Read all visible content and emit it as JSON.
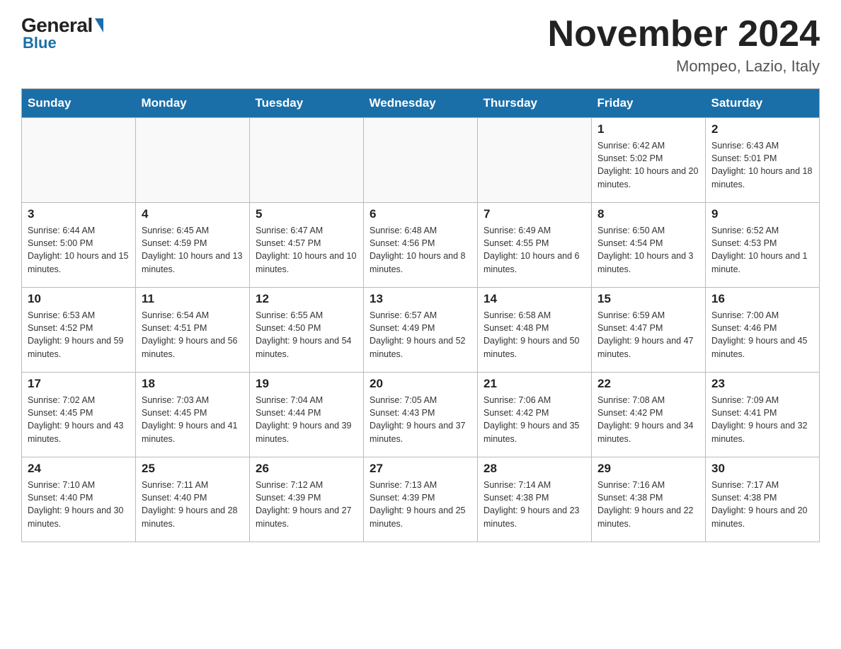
{
  "header": {
    "logo_general": "General",
    "logo_blue": "Blue",
    "title": "November 2024",
    "subtitle": "Mompeo, Lazio, Italy"
  },
  "weekdays": [
    "Sunday",
    "Monday",
    "Tuesday",
    "Wednesday",
    "Thursday",
    "Friday",
    "Saturday"
  ],
  "weeks": [
    [
      {
        "day": "",
        "sunrise": "",
        "sunset": "",
        "daylight": ""
      },
      {
        "day": "",
        "sunrise": "",
        "sunset": "",
        "daylight": ""
      },
      {
        "day": "",
        "sunrise": "",
        "sunset": "",
        "daylight": ""
      },
      {
        "day": "",
        "sunrise": "",
        "sunset": "",
        "daylight": ""
      },
      {
        "day": "",
        "sunrise": "",
        "sunset": "",
        "daylight": ""
      },
      {
        "day": "1",
        "sunrise": "Sunrise: 6:42 AM",
        "sunset": "Sunset: 5:02 PM",
        "daylight": "Daylight: 10 hours and 20 minutes."
      },
      {
        "day": "2",
        "sunrise": "Sunrise: 6:43 AM",
        "sunset": "Sunset: 5:01 PM",
        "daylight": "Daylight: 10 hours and 18 minutes."
      }
    ],
    [
      {
        "day": "3",
        "sunrise": "Sunrise: 6:44 AM",
        "sunset": "Sunset: 5:00 PM",
        "daylight": "Daylight: 10 hours and 15 minutes."
      },
      {
        "day": "4",
        "sunrise": "Sunrise: 6:45 AM",
        "sunset": "Sunset: 4:59 PM",
        "daylight": "Daylight: 10 hours and 13 minutes."
      },
      {
        "day": "5",
        "sunrise": "Sunrise: 6:47 AM",
        "sunset": "Sunset: 4:57 PM",
        "daylight": "Daylight: 10 hours and 10 minutes."
      },
      {
        "day": "6",
        "sunrise": "Sunrise: 6:48 AM",
        "sunset": "Sunset: 4:56 PM",
        "daylight": "Daylight: 10 hours and 8 minutes."
      },
      {
        "day": "7",
        "sunrise": "Sunrise: 6:49 AM",
        "sunset": "Sunset: 4:55 PM",
        "daylight": "Daylight: 10 hours and 6 minutes."
      },
      {
        "day": "8",
        "sunrise": "Sunrise: 6:50 AM",
        "sunset": "Sunset: 4:54 PM",
        "daylight": "Daylight: 10 hours and 3 minutes."
      },
      {
        "day": "9",
        "sunrise": "Sunrise: 6:52 AM",
        "sunset": "Sunset: 4:53 PM",
        "daylight": "Daylight: 10 hours and 1 minute."
      }
    ],
    [
      {
        "day": "10",
        "sunrise": "Sunrise: 6:53 AM",
        "sunset": "Sunset: 4:52 PM",
        "daylight": "Daylight: 9 hours and 59 minutes."
      },
      {
        "day": "11",
        "sunrise": "Sunrise: 6:54 AM",
        "sunset": "Sunset: 4:51 PM",
        "daylight": "Daylight: 9 hours and 56 minutes."
      },
      {
        "day": "12",
        "sunrise": "Sunrise: 6:55 AM",
        "sunset": "Sunset: 4:50 PM",
        "daylight": "Daylight: 9 hours and 54 minutes."
      },
      {
        "day": "13",
        "sunrise": "Sunrise: 6:57 AM",
        "sunset": "Sunset: 4:49 PM",
        "daylight": "Daylight: 9 hours and 52 minutes."
      },
      {
        "day": "14",
        "sunrise": "Sunrise: 6:58 AM",
        "sunset": "Sunset: 4:48 PM",
        "daylight": "Daylight: 9 hours and 50 minutes."
      },
      {
        "day": "15",
        "sunrise": "Sunrise: 6:59 AM",
        "sunset": "Sunset: 4:47 PM",
        "daylight": "Daylight: 9 hours and 47 minutes."
      },
      {
        "day": "16",
        "sunrise": "Sunrise: 7:00 AM",
        "sunset": "Sunset: 4:46 PM",
        "daylight": "Daylight: 9 hours and 45 minutes."
      }
    ],
    [
      {
        "day": "17",
        "sunrise": "Sunrise: 7:02 AM",
        "sunset": "Sunset: 4:45 PM",
        "daylight": "Daylight: 9 hours and 43 minutes."
      },
      {
        "day": "18",
        "sunrise": "Sunrise: 7:03 AM",
        "sunset": "Sunset: 4:45 PM",
        "daylight": "Daylight: 9 hours and 41 minutes."
      },
      {
        "day": "19",
        "sunrise": "Sunrise: 7:04 AM",
        "sunset": "Sunset: 4:44 PM",
        "daylight": "Daylight: 9 hours and 39 minutes."
      },
      {
        "day": "20",
        "sunrise": "Sunrise: 7:05 AM",
        "sunset": "Sunset: 4:43 PM",
        "daylight": "Daylight: 9 hours and 37 minutes."
      },
      {
        "day": "21",
        "sunrise": "Sunrise: 7:06 AM",
        "sunset": "Sunset: 4:42 PM",
        "daylight": "Daylight: 9 hours and 35 minutes."
      },
      {
        "day": "22",
        "sunrise": "Sunrise: 7:08 AM",
        "sunset": "Sunset: 4:42 PM",
        "daylight": "Daylight: 9 hours and 34 minutes."
      },
      {
        "day": "23",
        "sunrise": "Sunrise: 7:09 AM",
        "sunset": "Sunset: 4:41 PM",
        "daylight": "Daylight: 9 hours and 32 minutes."
      }
    ],
    [
      {
        "day": "24",
        "sunrise": "Sunrise: 7:10 AM",
        "sunset": "Sunset: 4:40 PM",
        "daylight": "Daylight: 9 hours and 30 minutes."
      },
      {
        "day": "25",
        "sunrise": "Sunrise: 7:11 AM",
        "sunset": "Sunset: 4:40 PM",
        "daylight": "Daylight: 9 hours and 28 minutes."
      },
      {
        "day": "26",
        "sunrise": "Sunrise: 7:12 AM",
        "sunset": "Sunset: 4:39 PM",
        "daylight": "Daylight: 9 hours and 27 minutes."
      },
      {
        "day": "27",
        "sunrise": "Sunrise: 7:13 AM",
        "sunset": "Sunset: 4:39 PM",
        "daylight": "Daylight: 9 hours and 25 minutes."
      },
      {
        "day": "28",
        "sunrise": "Sunrise: 7:14 AM",
        "sunset": "Sunset: 4:38 PM",
        "daylight": "Daylight: 9 hours and 23 minutes."
      },
      {
        "day": "29",
        "sunrise": "Sunrise: 7:16 AM",
        "sunset": "Sunset: 4:38 PM",
        "daylight": "Daylight: 9 hours and 22 minutes."
      },
      {
        "day": "30",
        "sunrise": "Sunrise: 7:17 AM",
        "sunset": "Sunset: 4:38 PM",
        "daylight": "Daylight: 9 hours and 20 minutes."
      }
    ]
  ]
}
